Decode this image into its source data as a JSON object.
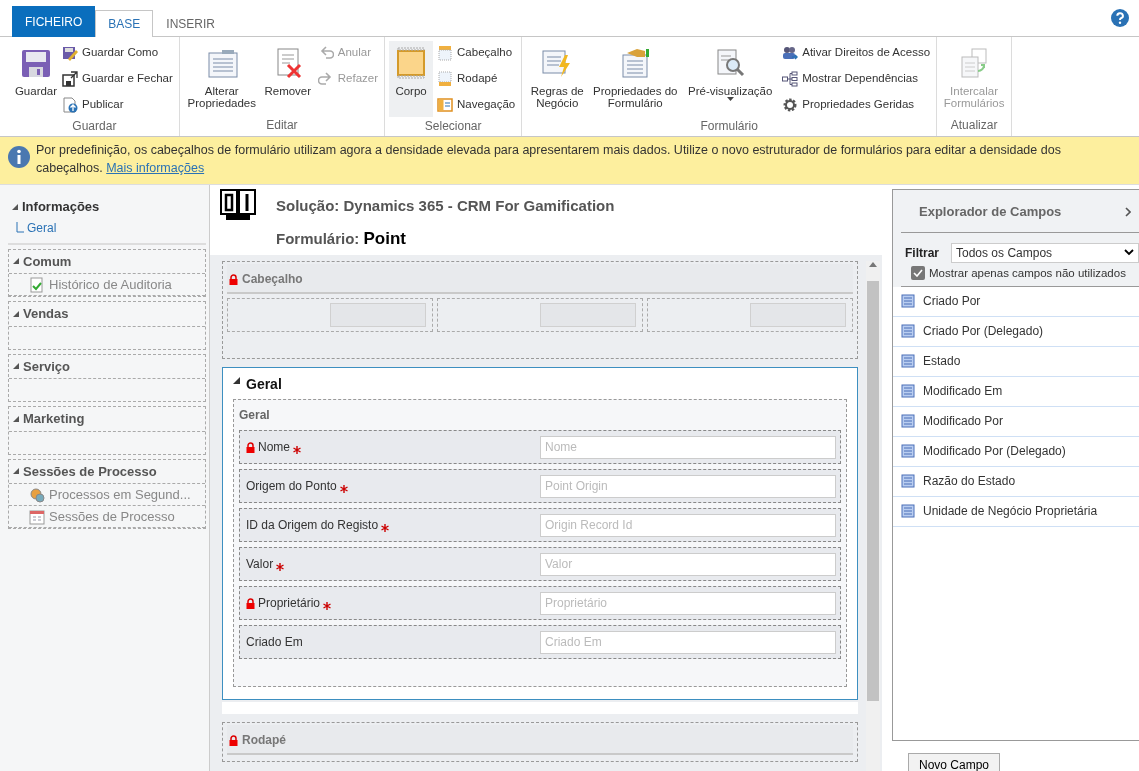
{
  "tabs": [
    {
      "label": "FICHEIRO",
      "kind": "file",
      "selected": false
    },
    {
      "label": "BASE",
      "kind": "tab",
      "selected": true
    },
    {
      "label": "INSERIR",
      "kind": "tab",
      "selected": false
    }
  ],
  "ribbon": {
    "groups": [
      {
        "label": "Guardar",
        "items": [
          {
            "label": "Guardar",
            "kind": "large",
            "disabled": false
          },
          {
            "label": "Guardar Como",
            "kind": "small",
            "disabled": false
          },
          {
            "label": "Guardar e Fechar",
            "kind": "small",
            "disabled": false
          },
          {
            "label": "Publicar",
            "kind": "small",
            "disabled": false
          }
        ]
      },
      {
        "label": "Editar",
        "items": [
          {
            "label": "Alterar Propriedades",
            "kind": "large",
            "disabled": false
          },
          {
            "label": "Remover",
            "kind": "large",
            "disabled": false
          },
          {
            "label": "Anular",
            "kind": "small",
            "disabled": true
          },
          {
            "label": "Refazer",
            "kind": "small",
            "disabled": true
          }
        ]
      },
      {
        "label": "Selecionar",
        "items": [
          {
            "label": "Corpo",
            "kind": "large",
            "disabled": false,
            "selected": true
          },
          {
            "label": "Cabeçalho",
            "kind": "small",
            "disabled": false,
            "selected": false
          },
          {
            "label": "Rodapé",
            "kind": "small",
            "disabled": false,
            "selected": false
          },
          {
            "label": "Navegação",
            "kind": "small",
            "disabled": false,
            "selected": false
          }
        ]
      },
      {
        "label": "Formulário",
        "items": [
          {
            "label": "Regras de Negócio",
            "kind": "large",
            "disabled": false
          },
          {
            "label": "Propriedades do Formulário",
            "kind": "large",
            "disabled": false
          },
          {
            "label": "Pré-visualização",
            "kind": "dropdown",
            "disabled": false
          },
          {
            "label": "Ativar Direitos de Acesso",
            "kind": "small",
            "disabled": false
          },
          {
            "label": "Mostrar Dependências",
            "kind": "small",
            "disabled": false
          },
          {
            "label": "Propriedades Geridas",
            "kind": "small",
            "disabled": false
          }
        ]
      },
      {
        "label": "Atualizar",
        "items": [
          {
            "label": "Intercalar Formulários",
            "kind": "large",
            "disabled": true
          }
        ]
      }
    ]
  },
  "notice": {
    "text": "Por predefinição, os cabeçalhos de formulário utilizam agora a densidade elevada para apresentarem mais dados. Utilize o novo estruturador de formulários para editar a densidade dos cabeçalhos.",
    "link": "Mais informações"
  },
  "navigation": [
    {
      "label": "Informações",
      "kind": "heading",
      "expanded": true,
      "children": [
        {
          "label": "Geral",
          "disabled": false
        }
      ]
    },
    {
      "label": "Comum",
      "kind": "group",
      "expanded": true,
      "children": [
        {
          "label": "Histórico de Auditoria",
          "disabled": true
        }
      ]
    },
    {
      "label": "Vendas",
      "kind": "group",
      "expanded": true
    },
    {
      "label": "Serviço",
      "kind": "group",
      "expanded": true
    },
    {
      "label": "Marketing",
      "kind": "group",
      "expanded": true
    },
    {
      "label": "Sessões de Processo",
      "kind": "group",
      "expanded": true,
      "children": [
        {
          "label": "Processos em Segund...",
          "disabled": true
        },
        {
          "label": "Sessões de Processo",
          "disabled": true
        }
      ]
    }
  ],
  "form": {
    "solution": "Solução: Dynamics 365 - CRM For Gamification",
    "form_name": "Formulário: **Point**",
    "header": {
      "label": "Cabeçalho",
      "locked": true
    },
    "tab": {
      "label": "Geral",
      "expanded": true,
      "section": {
        "label": "Geral",
        "fields": [
          {
            "label": "Nome",
            "locked": true,
            "required": true,
            "placeholder": "Nome"
          },
          {
            "label": "Origem do Ponto",
            "locked": false,
            "required": true,
            "placeholder": "Point Origin"
          },
          {
            "label": "ID da Origem do Registo",
            "locked": false,
            "required": true,
            "placeholder": "Origin Record Id"
          },
          {
            "label": "Valor",
            "locked": false,
            "required": true,
            "placeholder": "Valor"
          },
          {
            "label": "Proprietário",
            "locked": true,
            "required": true,
            "placeholder": "Proprietário"
          },
          {
            "label": "Criado Em",
            "locked": false,
            "required": false,
            "placeholder": "Criado Em"
          }
        ]
      }
    },
    "footer": {
      "label": "Rodapé",
      "locked": true
    }
  },
  "field_explorer": {
    "title": "Explorador de Campos",
    "filter_label": "Filtrar",
    "filter_value": "Todos os Campos",
    "unused_only": {
      "label": "Mostrar apenas campos não utilizados",
      "checked": true
    },
    "fields": [
      "Criado Por",
      "Criado Por (Delegado)",
      "Estado",
      "Modificado Em",
      "Modificado Por",
      "Modificado Por (Delegado)",
      "Razão do Estado",
      "Unidade de Negócio Proprietária"
    ],
    "new_button": "Novo Campo"
  }
}
